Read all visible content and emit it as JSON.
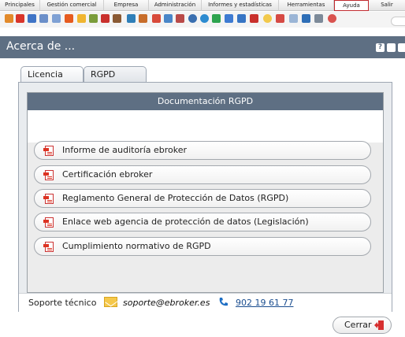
{
  "menu": {
    "items": [
      "Principales",
      "Gestión comercial",
      "Empresa",
      "Administración",
      "Informes y estadísticas",
      "Herramientas",
      "Ayuda",
      "Salir"
    ],
    "active": "Ayuda"
  },
  "toolbar": {
    "icons": [
      "orange-box-icon",
      "red-star-icon",
      "blue-card-icon",
      "card-icon",
      "card-icon",
      "fire-icon",
      "yellow-arrow-icon",
      "pencil-icon",
      "alarm-icon",
      "briefcase-icon",
      "refresh-icon",
      "people-icon",
      "calendar-icon",
      "mail-icon",
      "chart-icon",
      "euro-icon",
      "globe-icon",
      "map-icon",
      "shield-icon",
      "blue-doc-icon",
      "red-doc-icon",
      "bulb-icon",
      "red-doc-icon",
      "doc-icon",
      "phone-icon",
      "gears-icon",
      "help-icon"
    ]
  },
  "window": {
    "title": "Acerca de ...",
    "buttons": [
      "?"
    ]
  },
  "tabs": [
    {
      "label": "Licencia",
      "active": false
    },
    {
      "label": "RGPD",
      "active": true
    }
  ],
  "panel": {
    "header": "Documentación RGPD",
    "documents": [
      "Informe de auditoría ebroker",
      "Certificación ebroker",
      "Reglamento General de Protección de Datos (RGPD)",
      "Enlace web agencia de protección de datos (Legislación)",
      "Cumplimiento normativo de RGPD"
    ]
  },
  "support": {
    "label": "Soporte técnico",
    "email": "soporte@ebroker.es",
    "phone": "902 19 61 77"
  },
  "actions": {
    "close_label": "Cerrar"
  },
  "colors": {
    "header_bg": "#5e6f83",
    "active_menu_border": "#c0282d"
  }
}
